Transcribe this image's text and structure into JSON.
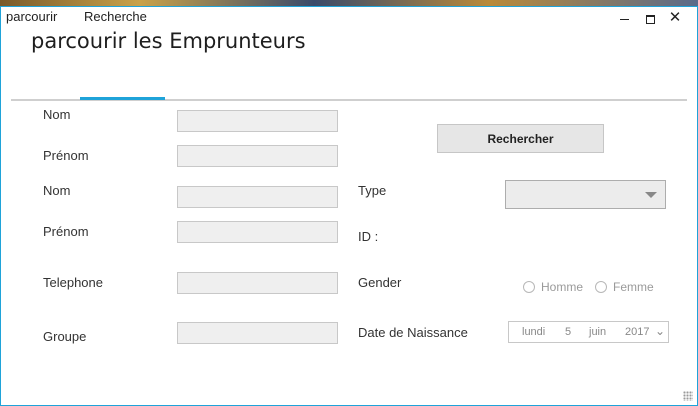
{
  "window": {
    "title": "parcourir les Emprunteurs",
    "minimize": "",
    "maximize": "",
    "close": "✕"
  },
  "tabs": [
    {
      "label": "parcourir"
    },
    {
      "label": "Recherche",
      "active": true
    }
  ],
  "search": {
    "nom_label": "Nom",
    "prenom_label": "Prénom",
    "button_label": "Rechercher"
  },
  "details": {
    "nom_label": "Nom",
    "prenom_label": "Prénom",
    "telephone_label": "Telephone",
    "groupe_label": "Groupe",
    "type_label": "Type",
    "id_label": "ID :",
    "gender_label": "Gender",
    "dob_label": "Date de Naissance",
    "gender_options": [
      "Homme",
      "Femme"
    ],
    "dob": {
      "day_name": "lundi",
      "day": "5",
      "month": "juin",
      "year": "2017"
    }
  },
  "colors": {
    "accent": "#1fa3d9",
    "input_bg": "#efefef"
  }
}
